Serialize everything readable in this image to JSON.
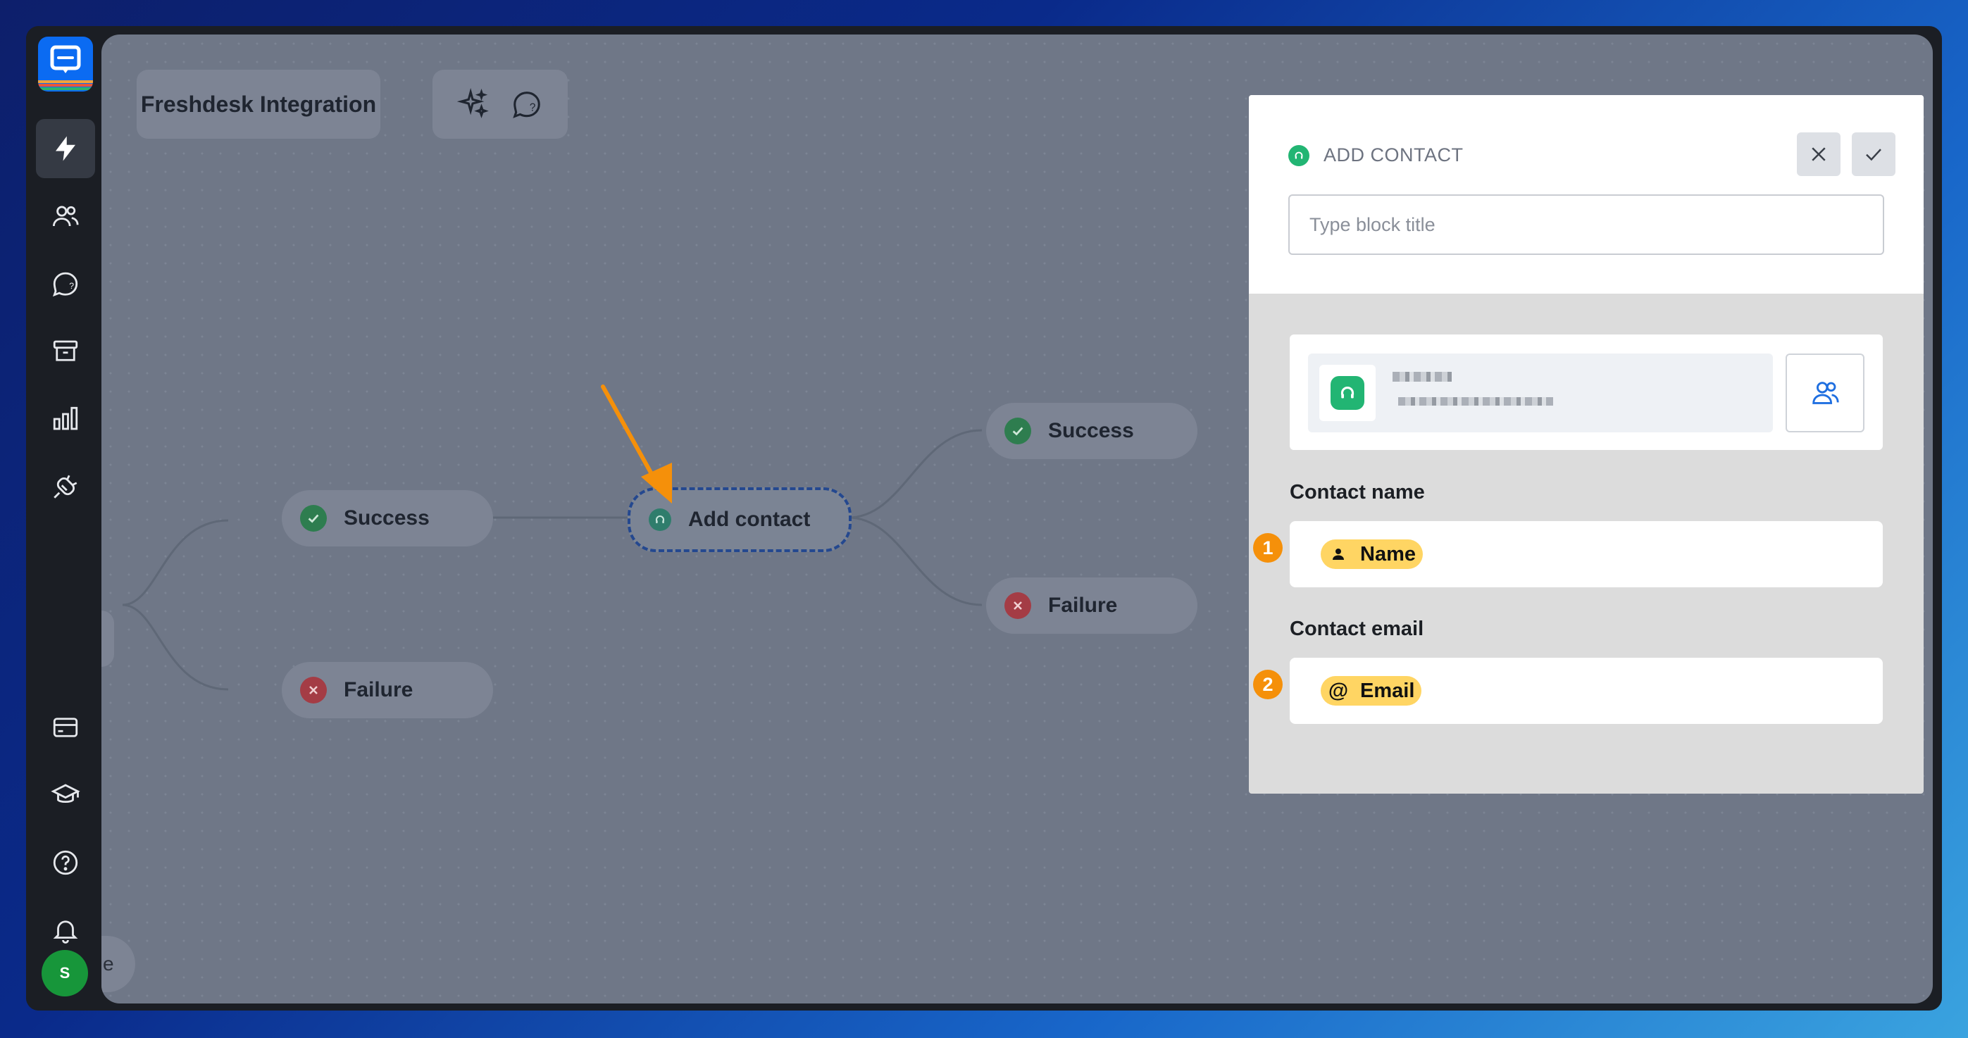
{
  "app": {
    "workflow_title": "Freshdesk Integration",
    "avatar_initial": "S"
  },
  "sidebar": {
    "items": [
      {
        "name": "automation",
        "icon": "bolt-icon",
        "active": true
      },
      {
        "name": "contacts",
        "icon": "users-icon",
        "active": false
      },
      {
        "name": "chats",
        "icon": "chat-bubble-icon",
        "active": false
      },
      {
        "name": "archive",
        "icon": "archive-icon",
        "active": false
      },
      {
        "name": "reports",
        "icon": "bar-chart-icon",
        "active": false
      },
      {
        "name": "integrations",
        "icon": "plug-icon",
        "active": false
      },
      {
        "name": "billing",
        "icon": "credit-card-icon",
        "active": false
      },
      {
        "name": "academy",
        "icon": "graduation-cap-icon",
        "active": false
      },
      {
        "name": "help",
        "icon": "question-icon",
        "active": false
      },
      {
        "name": "notifications",
        "icon": "bell-icon",
        "active": false
      }
    ]
  },
  "canvas": {
    "nodes": {
      "success_left": "Success",
      "failure_left": "Failure",
      "add_contact": "Add contact",
      "success_right": "Success",
      "failure_right": "Failure"
    },
    "collapse_label": "e"
  },
  "panel": {
    "header": "ADD CONTACT",
    "title_placeholder": "Type block title",
    "contact_name_label": "Contact name",
    "contact_name_chip": "Name",
    "contact_email_label": "Contact email",
    "contact_email_chip": "Email",
    "email_chip_symbol": "@",
    "step_badges": [
      "1",
      "2"
    ]
  },
  "colors": {
    "accent_orange": "#f5900a",
    "chip_yellow": "#ffd563",
    "freshdesk_green": "#22b573",
    "success_green": "#2e7d4f",
    "failure_red": "#a43c45",
    "brand_blue": "#0b6bf2"
  }
}
